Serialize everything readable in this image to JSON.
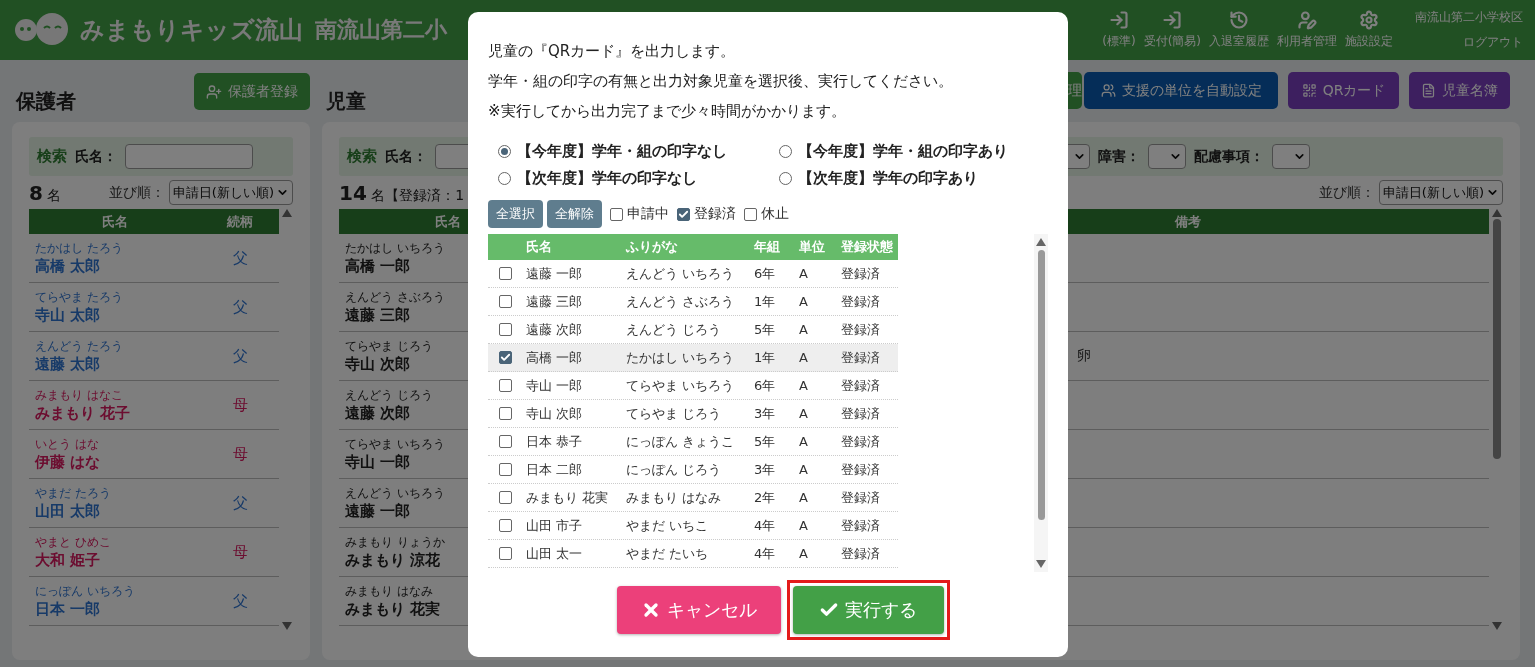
{
  "header": {
    "logo": "みまもりキッズ流山",
    "school": "南流山第二小",
    "nav": [
      {
        "label": "(標準)",
        "kind": "enter"
      },
      {
        "label": "受付(簡易)",
        "kind": "enter"
      },
      {
        "label": "入退室履歴",
        "kind": "history"
      },
      {
        "label": "利用者管理",
        "kind": "user"
      },
      {
        "label": "施設設定",
        "kind": "settings"
      }
    ],
    "district": "南流山第二小学校区",
    "logout": "ログアウト"
  },
  "guardians": {
    "title": "保護者",
    "register_button": "保護者登録",
    "search_label": "検索",
    "name_label": "氏名：",
    "count": "8",
    "count_unit": "名",
    "sort_label": "並び順：",
    "sort_value": "申請日(新しい順)",
    "columns": [
      "氏名",
      "続柄"
    ],
    "rows": [
      {
        "kana": "たかはし たろう",
        "name": "高橋 太郎",
        "relation": "父",
        "kind": "father"
      },
      {
        "kana": "てらやま たろう",
        "name": "寺山 太郎",
        "relation": "父",
        "kind": "father"
      },
      {
        "kana": "えんどう たろう",
        "name": "遠藤 太郎",
        "relation": "父",
        "kind": "father"
      },
      {
        "kana": "みまもり はなこ",
        "name": "みまもり 花子",
        "relation": "母",
        "kind": "mother"
      },
      {
        "kana": "いとう はな",
        "name": "伊藤 はな",
        "relation": "母",
        "kind": "mother"
      },
      {
        "kana": "やまだ たろう",
        "name": "山田 太郎",
        "relation": "父",
        "kind": "father"
      },
      {
        "kana": "やまと ひめこ",
        "name": "大和 姫子",
        "relation": "母",
        "kind": "mother"
      },
      {
        "kana": "にっぽん いちろう",
        "name": "日本 一郎",
        "relation": "父",
        "kind": "father"
      }
    ]
  },
  "children": {
    "title": "児童",
    "buttons": [
      {
        "label": "理",
        "kind": "manage"
      },
      {
        "label": "支援の単位を自動設定",
        "kind": "group"
      },
      {
        "label": "QRカード",
        "kind": "qr"
      },
      {
        "label": "児童名簿",
        "kind": "list"
      }
    ],
    "search_label": "検索",
    "name_label": "氏名：",
    "filters": [
      {
        "label": "障害："
      },
      {
        "label": "配慮事項："
      }
    ],
    "count": "14",
    "count_tail": "名【登録済：1",
    "sort_label": "並び順：",
    "sort_value": "申請日(新しい順)",
    "columns": {
      "name": "氏名",
      "note": "備考"
    },
    "rows": [
      {
        "kana": "たかはし いちろう",
        "name": "高橋 一郎"
      },
      {
        "kana": "えんどう さぶろう",
        "name": "遠藤 三郎"
      },
      {
        "kana": "てらやま じろう",
        "name": "寺山 次郎",
        "note": "卵"
      },
      {
        "kana": "えんどう じろう",
        "name": "遠藤 次郎"
      },
      {
        "kana": "てらやま いちろう",
        "name": "寺山 一郎"
      },
      {
        "kana": "えんどう いちろう",
        "name": "遠藤 一郎"
      },
      {
        "kana": "みまもり りょうか",
        "name": "みまもり 涼花"
      },
      {
        "kana": "みまもり はなみ",
        "name": "みまもり 花実"
      }
    ]
  },
  "dialog": {
    "lines": [
      "児童の『QRカード』を出力します。",
      "学年・組の印字の有無と出力対象児童を選択後、実行してください。",
      "※実行してから出力完了まで少々時間がかかります。"
    ],
    "options": [
      {
        "label": "【今年度】学年・組の印字なし",
        "selected": true
      },
      {
        "label": "【今年度】学年・組の印字あり",
        "selected": false
      },
      {
        "label": "【次年度】学年の印字なし",
        "selected": false
      },
      {
        "label": "【次年度】学年の印字あり",
        "selected": false
      }
    ],
    "select_all": "全選択",
    "clear_all": "全解除",
    "status_filters": [
      {
        "label": "申請中",
        "checked": false
      },
      {
        "label": "登録済",
        "checked": true
      },
      {
        "label": "休止",
        "checked": false
      }
    ],
    "columns": [
      "氏名",
      "ふりがな",
      "年組",
      "単位",
      "登録状態"
    ],
    "students": [
      {
        "name": "遠藤 一郎",
        "kana": "えんどう いちろう",
        "grade": "6年",
        "unit": "A",
        "status": "登録済",
        "checked": false
      },
      {
        "name": "遠藤 三郎",
        "kana": "えんどう さぶろう",
        "grade": "1年",
        "unit": "A",
        "status": "登録済",
        "checked": false
      },
      {
        "name": "遠藤 次郎",
        "kana": "えんどう じろう",
        "grade": "5年",
        "unit": "A",
        "status": "登録済",
        "checked": false
      },
      {
        "name": "高橋 一郎",
        "kana": "たかはし いちろう",
        "grade": "1年",
        "unit": "A",
        "status": "登録済",
        "checked": true
      },
      {
        "name": "寺山 一郎",
        "kana": "てらやま いちろう",
        "grade": "6年",
        "unit": "A",
        "status": "登録済",
        "checked": false
      },
      {
        "name": "寺山 次郎",
        "kana": "てらやま じろう",
        "grade": "3年",
        "unit": "A",
        "status": "登録済",
        "checked": false
      },
      {
        "name": "日本 恭子",
        "kana": "にっぽん きょうこ",
        "grade": "5年",
        "unit": "A",
        "status": "登録済",
        "checked": false
      },
      {
        "name": "日本 二郎",
        "kana": "にっぽん じろう",
        "grade": "3年",
        "unit": "A",
        "status": "登録済",
        "checked": false
      },
      {
        "name": "みまもり 花実",
        "kana": "みまもり はなみ",
        "grade": "2年",
        "unit": "A",
        "status": "登録済",
        "checked": false
      },
      {
        "name": "山田 市子",
        "kana": "やまだ いちこ",
        "grade": "4年",
        "unit": "A",
        "status": "登録済",
        "checked": false
      },
      {
        "name": "山田 太一",
        "kana": "やまだ たいち",
        "grade": "4年",
        "unit": "A",
        "status": "登録済",
        "checked": false
      }
    ],
    "cancel_button": "キャンセル",
    "run_button": "実行する",
    "run_highlighted": true
  }
}
